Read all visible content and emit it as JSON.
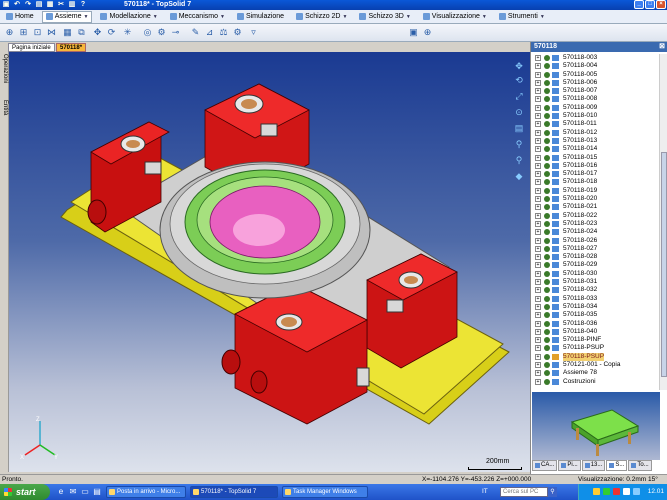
{
  "window": {
    "title": "570118* - TopSolid 7"
  },
  "menu": {
    "tabs": [
      {
        "label": "Home",
        "active": false
      },
      {
        "label": "Assieme",
        "active": true
      },
      {
        "label": "Modellazione",
        "active": false
      },
      {
        "label": "Meccanismo",
        "active": false
      },
      {
        "label": "Simulazione",
        "active": false
      },
      {
        "label": "Schizzo 2D",
        "active": false
      },
      {
        "label": "Schizzo 3D",
        "active": false
      },
      {
        "label": "Visualizzazione",
        "active": false
      },
      {
        "label": "Strumenti",
        "active": false
      }
    ]
  },
  "doc_tabs": {
    "home": "Pagina iniziale",
    "active": "570118*"
  },
  "left_tabs": {
    "operations": "Operazioni",
    "entities": "Entità"
  },
  "panel": {
    "title": "570118",
    "items": [
      "570118-003",
      "570118-004",
      "570118-005",
      "570118-006",
      "570118-007",
      "570118-008",
      "570118-009",
      "570118-010",
      "570118-011",
      "570118-012",
      "570118-013",
      "570118-014",
      "570118-015",
      "570118-016",
      "570118-017",
      "570118-018",
      "570118-019",
      "570118-020",
      "570118-021",
      "570118-022",
      "570118-023",
      "570118-024",
      "570118-026",
      "570118-027",
      "570118-028",
      "570118-029",
      "570118-030",
      "570118-031",
      "570118-032",
      "570118-033",
      "570118-034",
      "570118-035",
      "570118-036",
      "570118-040",
      "570118-PINF",
      "570118-PSUP",
      "570118-PSUP",
      "570121-001 - Copia",
      "Assieme 78",
      "Costruzioni"
    ],
    "highlighted_index": 36,
    "tabs": [
      "CA...",
      "Pi...",
      "13...",
      "S...",
      "To..."
    ]
  },
  "viewport": {
    "scale_label": "200mm",
    "axis_labels": [
      "Z",
      "X",
      "Y"
    ]
  },
  "status": {
    "left": "Pronto.",
    "coords": "X=-1104.276  Y=-453.226  Z=+000.000",
    "view": "Visualizzazione: 0.2mm 15°"
  },
  "taskbar": {
    "start": "start",
    "tasks": [
      "Posta in arrivo - Micro...",
      "570118* - TopSolid 7",
      "Task Manager Windows"
    ],
    "active_task": 1,
    "lang": "IT",
    "search_placeholder": "Cerca sul PC",
    "clock": "12.01"
  },
  "colors": {
    "frame_red": "#e01818",
    "base_yellow": "#e8e02a",
    "ring_green": "#8ed86a",
    "cavity_pink": "#f070c8",
    "ring_gray": "#c8c8c8",
    "highlight": "#f2d070"
  }
}
